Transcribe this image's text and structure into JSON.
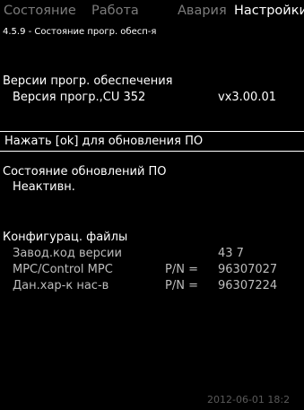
{
  "tabs": [
    {
      "label": "Состояние",
      "active": false
    },
    {
      "label": "Работа",
      "active": false
    },
    {
      "label": "Авария",
      "active": false
    },
    {
      "label": "Настройки",
      "active": true
    }
  ],
  "subtitle": "4.5.9 - Состояние прогр. обесп-я",
  "software_versions": {
    "heading": "Версии прогр. обеспечения",
    "item_label": "Версия прогр.,CU 352",
    "item_value": "vx3.00.01"
  },
  "update_action": {
    "label": "Нажать [ok] для обновления ПО"
  },
  "update_status": {
    "heading": "Состояние обновлений ПО",
    "value": "Неактивн."
  },
  "config_files": {
    "heading": "Конфигурац. файлы",
    "rows": [
      {
        "label": "Завод.код версии",
        "pn_label": "",
        "value": "43   7"
      },
      {
        "label": "MPC/Control MPC",
        "pn_label": "P/N =",
        "value": "96307027"
      },
      {
        "label": "Дан.хар-к нас-в",
        "pn_label": "P/N =",
        "value": "96307224"
      }
    ]
  },
  "footer": {
    "datetime": "2012-06-01 18:2"
  },
  "colors": {
    "background": "#000000",
    "text": "#ffffff",
    "inactive_tab": "#7c7c7c",
    "footer": "#5a5a5a"
  }
}
